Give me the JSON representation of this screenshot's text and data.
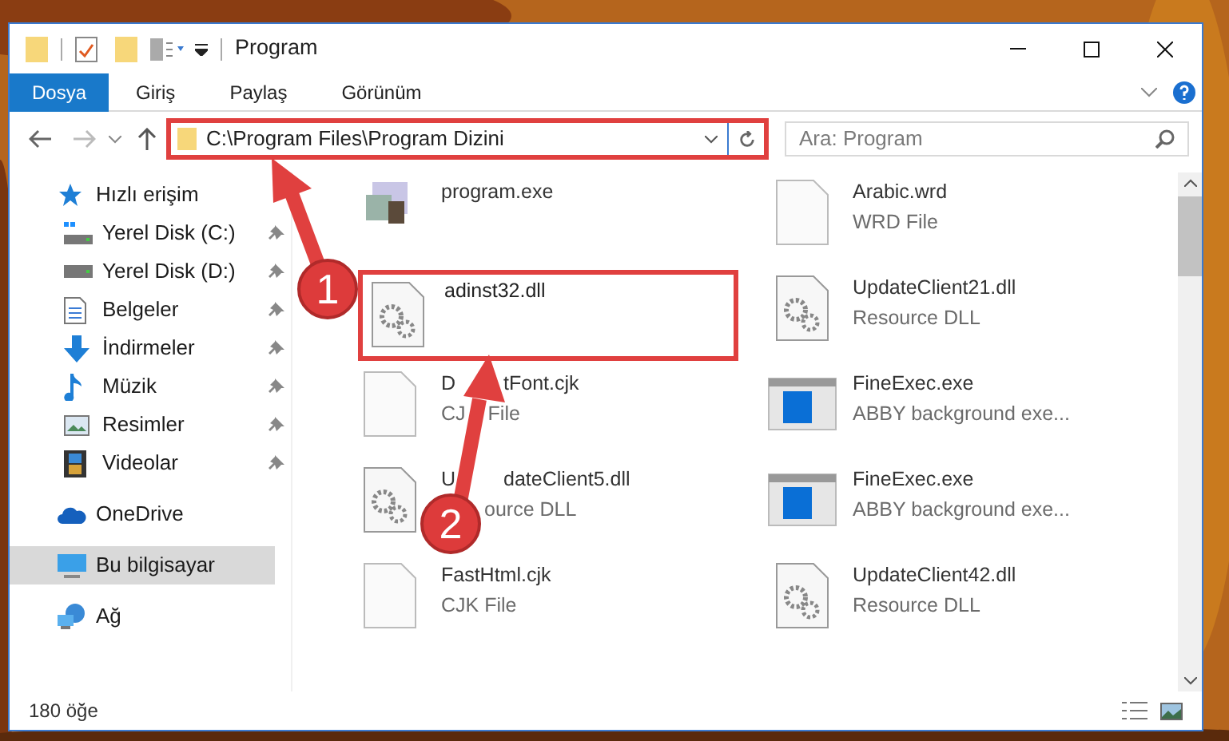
{
  "window": {
    "title": "Program"
  },
  "ribbon_tabs": [
    {
      "label": "Dosya",
      "selected": true
    },
    {
      "label": "Giriş",
      "selected": false
    },
    {
      "label": "Paylaş",
      "selected": false
    },
    {
      "label": "Görünüm",
      "selected": false
    }
  ],
  "address": {
    "path": "C:\\Program Files\\Program Dizini",
    "highlighted": true
  },
  "search": {
    "placeholder": "Ara: Program"
  },
  "sidebar": {
    "items": [
      {
        "label": "Hızlı erişim",
        "kind": "quickaccess",
        "selected": false,
        "children": [
          {
            "label": "Yerel Disk (C:)",
            "kind": "systemdrive",
            "pinned": true,
            "selected": false
          },
          {
            "label": "Yerel Disk (D:)",
            "kind": "drive",
            "pinned": true,
            "selected": false
          },
          {
            "label": "Belgeler",
            "kind": "documents",
            "pinned": true,
            "selected": false
          },
          {
            "label": "İndirmeler",
            "kind": "downloads",
            "pinned": true,
            "selected": false
          },
          {
            "label": "Müzik",
            "kind": "music",
            "pinned": true,
            "selected": false
          },
          {
            "label": "Resimler",
            "kind": "pictures",
            "pinned": true,
            "selected": false
          },
          {
            "label": "Videolar",
            "kind": "videos",
            "pinned": true,
            "selected": false
          }
        ]
      },
      {
        "label": "OneDrive",
        "kind": "cloud",
        "selected": false
      },
      {
        "label": "Bu bilgisayar",
        "kind": "computer",
        "selected": true
      },
      {
        "label": "Ağ",
        "kind": "network",
        "selected": false
      }
    ]
  },
  "files": [
    {
      "name": [
        "program.exe"
      ],
      "kind": "installer",
      "highlighted": false
    },
    {
      "name": [
        "Arabic.wrd"
      ],
      "type": [
        "WRD File"
      ],
      "kind": "blank",
      "highlighted": false
    },
    {
      "name": [
        "adinst32.dll"
      ],
      "kind": "dll",
      "highlighted": true
    },
    {
      "name": [
        "UpdateClient21.dll"
      ],
      "type": [
        "Resource DLL"
      ],
      "kind": "dll",
      "highlighted": false
    },
    {
      "name": [
        "D",
        "tFont.cjk"
      ],
      "type": [
        "CJ",
        "File"
      ],
      "kind": "blank",
      "highlighted": false
    },
    {
      "name": [
        "FineExec.exe"
      ],
      "type": [
        "ABBY background exe..."
      ],
      "kind": "app",
      "highlighted": false
    },
    {
      "name": [
        "U",
        "dateClient5.dll"
      ],
      "type": [
        "ource DLL"
      ],
      "kind": "dll",
      "highlighted": false
    },
    {
      "name": [
        "FineExec.exe"
      ],
      "type": [
        "ABBY background exe..."
      ],
      "kind": "app",
      "highlighted": false
    },
    {
      "name": [
        "FastHtml.cjk"
      ],
      "type": [
        "CJK File"
      ],
      "kind": "blank",
      "highlighted": false
    },
    {
      "name": [
        "UpdateClient42.dll"
      ],
      "type": [
        "Resource DLL"
      ],
      "kind": "dll",
      "highlighted": false
    }
  ],
  "status_bar": {
    "count": "180 öğe"
  },
  "annotations": [
    {
      "number": "1"
    },
    {
      "number": "2"
    }
  ]
}
